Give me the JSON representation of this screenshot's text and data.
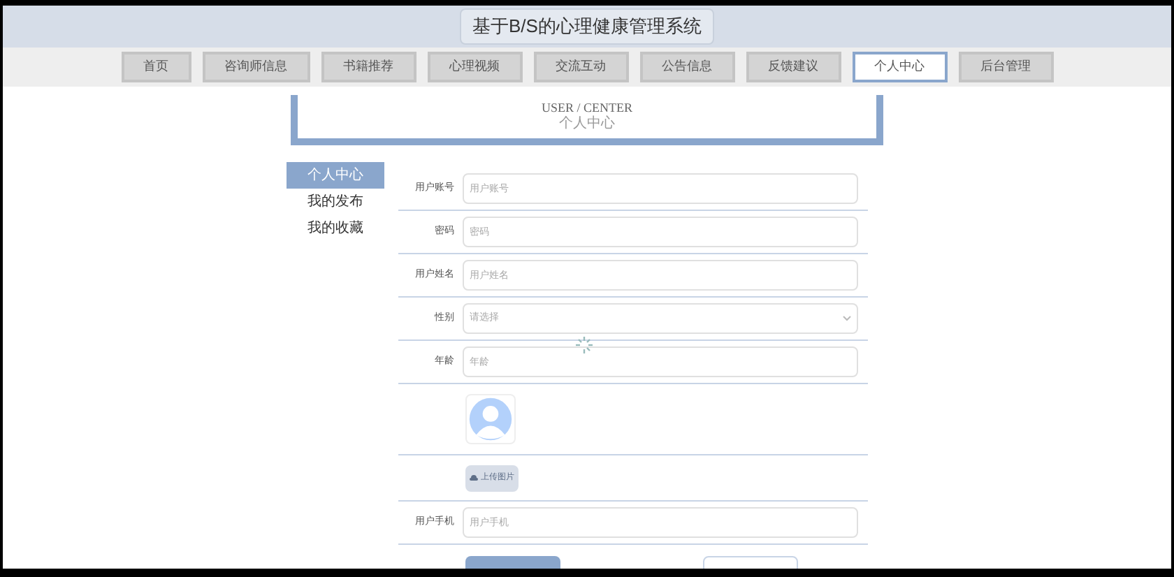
{
  "header": {
    "title": "基于B/S的心理健康管理系统"
  },
  "nav": [
    {
      "label": "首页",
      "selected": false
    },
    {
      "label": "咨询师信息",
      "selected": false
    },
    {
      "label": "书籍推荐",
      "selected": false
    },
    {
      "label": "心理视频",
      "selected": false
    },
    {
      "label": "交流互动",
      "selected": false
    },
    {
      "label": "公告信息",
      "selected": false
    },
    {
      "label": "反馈建议",
      "selected": false
    },
    {
      "label": "个人中心",
      "selected": true
    },
    {
      "label": "后台管理",
      "selected": false
    }
  ],
  "banner": {
    "subtitle": "USER / CENTER",
    "title": "个人中心"
  },
  "sidebar": [
    {
      "label": "个人中心",
      "selected": true
    },
    {
      "label": "我的发布",
      "selected": false
    },
    {
      "label": "我的收藏",
      "selected": false
    }
  ],
  "form": [
    {
      "kind": "input",
      "label": "用户账号",
      "placeholder": "用户账号"
    },
    {
      "kind": "input",
      "label": "密码",
      "placeholder": "密码"
    },
    {
      "kind": "input",
      "label": "用户姓名",
      "placeholder": "用户姓名"
    },
    {
      "kind": "select",
      "label": "性别",
      "placeholder": "请选择"
    },
    {
      "kind": "input",
      "label": "年龄",
      "placeholder": "年龄"
    },
    {
      "kind": "avatar"
    },
    {
      "kind": "upload",
      "button": "上传图片"
    },
    {
      "kind": "input",
      "label": "用户手机",
      "placeholder": "用户手机"
    }
  ],
  "actions": [
    {
      "kind": "primary"
    },
    {
      "kind": "secondary"
    }
  ]
}
